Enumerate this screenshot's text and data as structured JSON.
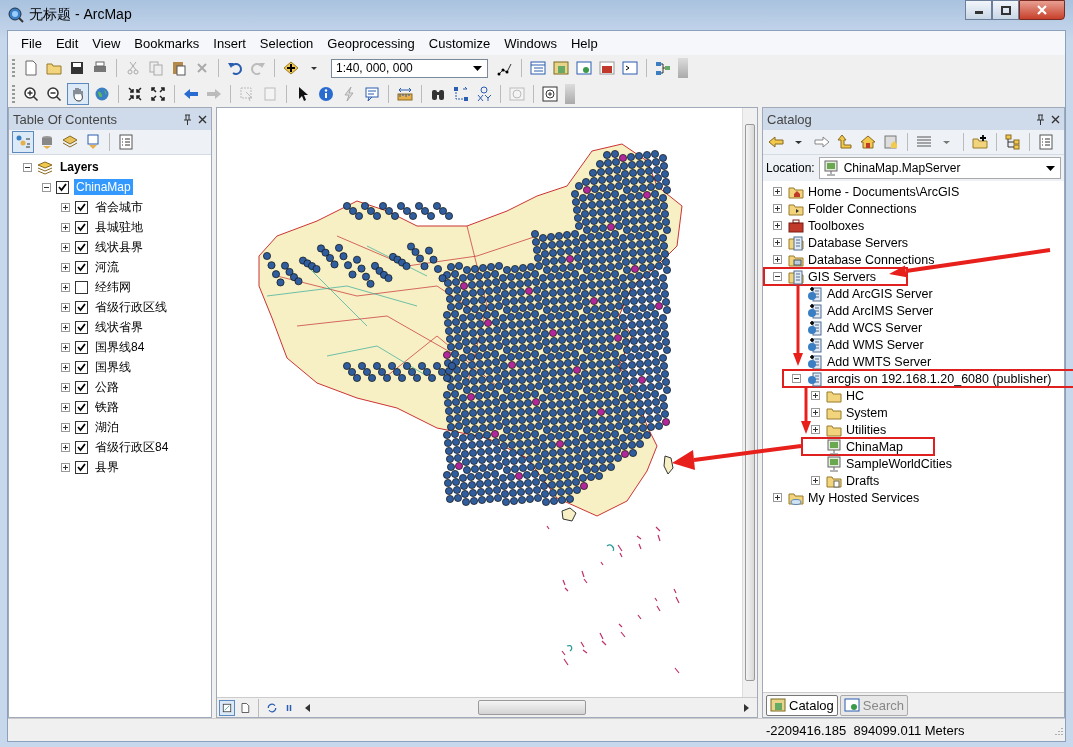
{
  "window": {
    "title": "无标题 - ArcMap"
  },
  "menu": [
    "File",
    "Edit",
    "View",
    "Bookmarks",
    "Insert",
    "Selection",
    "Geoprocessing",
    "Customize",
    "Windows",
    "Help"
  ],
  "toolbar": {
    "scale": "1:40, 000, 000"
  },
  "toc": {
    "title": "Table Of Contents",
    "layers": [
      {
        "label": "Layers",
        "kind": "data-frame",
        "expanded": true,
        "children": [
          {
            "label": "ChinaMap",
            "checked": true,
            "selected": true,
            "expanded": true,
            "children": [
              {
                "label": "省会城市",
                "checked": true,
                "expanded": false
              },
              {
                "label": "县城驻地",
                "checked": true,
                "expanded": false
              },
              {
                "label": "线状县界",
                "checked": true,
                "expanded": false
              },
              {
                "label": "河流",
                "checked": true,
                "expanded": false
              },
              {
                "label": "经纬网",
                "checked": false,
                "expanded": false
              },
              {
                "label": "省级行政区线",
                "checked": true,
                "expanded": false
              },
              {
                "label": "线状省界",
                "checked": true,
                "expanded": false
              },
              {
                "label": "国界线84",
                "checked": true,
                "expanded": false
              },
              {
                "label": "国界线",
                "checked": true,
                "expanded": false
              },
              {
                "label": "公路",
                "checked": true,
                "expanded": false
              },
              {
                "label": "铁路",
                "checked": true,
                "expanded": false
              },
              {
                "label": "湖泊",
                "checked": true,
                "expanded": false
              },
              {
                "label": "省级行政区84",
                "checked": true,
                "expanded": false
              },
              {
                "label": "县界",
                "checked": true,
                "expanded": false
              }
            ]
          }
        ]
      }
    ]
  },
  "catalog": {
    "title": "Catalog",
    "location_label": "Location:",
    "location": "ChinaMap.MapServer",
    "tree": [
      {
        "label": "Home - Documents\\ArcGIS",
        "kind": "home",
        "expanded": false,
        "highlighted": false
      },
      {
        "label": "Folder Connections",
        "kind": "folder-link",
        "expanded": false,
        "highlighted": false
      },
      {
        "label": "Toolboxes",
        "kind": "toolbox",
        "expanded": false,
        "highlighted": false
      },
      {
        "label": "Database Servers",
        "kind": "db-server",
        "expanded": false,
        "highlighted": false
      },
      {
        "label": "Database Connections",
        "kind": "db-conn",
        "expanded": false,
        "highlighted": false
      },
      {
        "label": "GIS Servers",
        "kind": "gis-servers",
        "expanded": true,
        "highlighted": true,
        "children": [
          {
            "label": "Add ArcGIS Server",
            "kind": "add-server",
            "highlighted": false
          },
          {
            "label": "Add ArcIMS Server",
            "kind": "add-server",
            "highlighted": false
          },
          {
            "label": "Add WCS Server",
            "kind": "add-server",
            "highlighted": false
          },
          {
            "label": "Add WMS Server",
            "kind": "add-server",
            "highlighted": false
          },
          {
            "label": "Add WMTS Server",
            "kind": "add-server",
            "highlighted": false
          },
          {
            "label": "arcgis on 192.168.1.20_6080 (publisher)",
            "kind": "server",
            "expanded": true,
            "highlighted": true,
            "children": [
              {
                "label": "HC",
                "kind": "folder",
                "expanded": false,
                "highlighted": false
              },
              {
                "label": "System",
                "kind": "folder",
                "expanded": false,
                "highlighted": false
              },
              {
                "label": "Utilities",
                "kind": "folder",
                "expanded": false,
                "highlighted": false
              },
              {
                "label": "ChinaMap",
                "kind": "service",
                "highlighted": true
              },
              {
                "label": "SampleWorldCities",
                "kind": "service",
                "highlighted": false
              },
              {
                "label": "Drafts",
                "kind": "drafts",
                "expanded": false,
                "highlighted": false
              }
            ]
          }
        ]
      },
      {
        "label": "My Hosted Services",
        "kind": "hosted",
        "expanded": false,
        "highlighted": false
      }
    ],
    "tabs": [
      {
        "label": "Catalog",
        "selected": true
      },
      {
        "label": "Search",
        "selected": false
      }
    ]
  },
  "status_bar": {
    "coordinates": "-2209416.185  894099.011 Meters"
  }
}
